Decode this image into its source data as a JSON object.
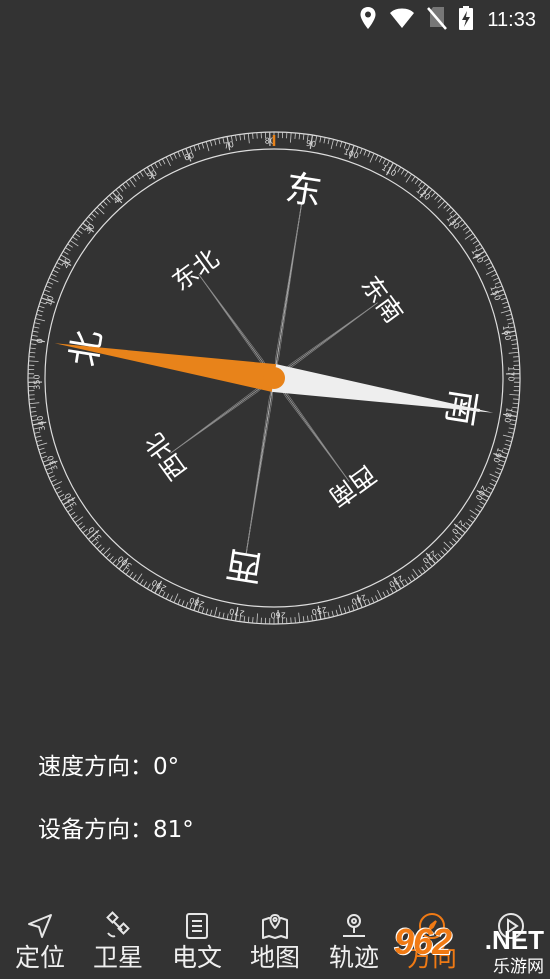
{
  "status_bar": {
    "time": "11:33",
    "icons": [
      "location-icon",
      "wifi-icon",
      "no-sim-icon",
      "battery-charging-icon"
    ]
  },
  "compass": {
    "heading_deg": 81,
    "outer_ticks": [
      "0",
      "10",
      "20",
      "30",
      "40",
      "50",
      "60",
      "70",
      "80",
      "90",
      "100",
      "110",
      "120",
      "130",
      "140",
      "150",
      "160",
      "170",
      "180",
      "190",
      "200",
      "210",
      "220",
      "230",
      "240",
      "250",
      "260",
      "270",
      "280",
      "290",
      "300",
      "310",
      "320",
      "330",
      "340",
      "350"
    ],
    "directions": {
      "north": "北",
      "east": "东",
      "south": "南",
      "west": "西",
      "northeast": "东北",
      "southeast": "东南",
      "southwest": "西南",
      "northwest": "西北"
    },
    "colors": {
      "needle_north": "#e8831a",
      "needle_south": "#eeeeee",
      "ring": "#dddddd",
      "marker": "#e8831a"
    }
  },
  "info": {
    "speed_label": "速度方向：",
    "speed_value": "0°",
    "device_label": "设备方向：",
    "device_value": "81°"
  },
  "nav": {
    "items": [
      {
        "label": "定位",
        "icon": "navigation-arrow-icon"
      },
      {
        "label": "卫星",
        "icon": "satellite-icon"
      },
      {
        "label": "电文",
        "icon": "document-icon"
      },
      {
        "label": "地图",
        "icon": "map-icon"
      },
      {
        "label": "轨迹",
        "icon": "track-pin-icon"
      },
      {
        "label": "方向",
        "icon": "compass-icon"
      },
      {
        "label": "",
        "icon": "play-icon"
      }
    ],
    "active_color": "#f07a14"
  },
  "watermark": {
    "logo": "962",
    "net": ".NET",
    "site": "乐游网"
  }
}
